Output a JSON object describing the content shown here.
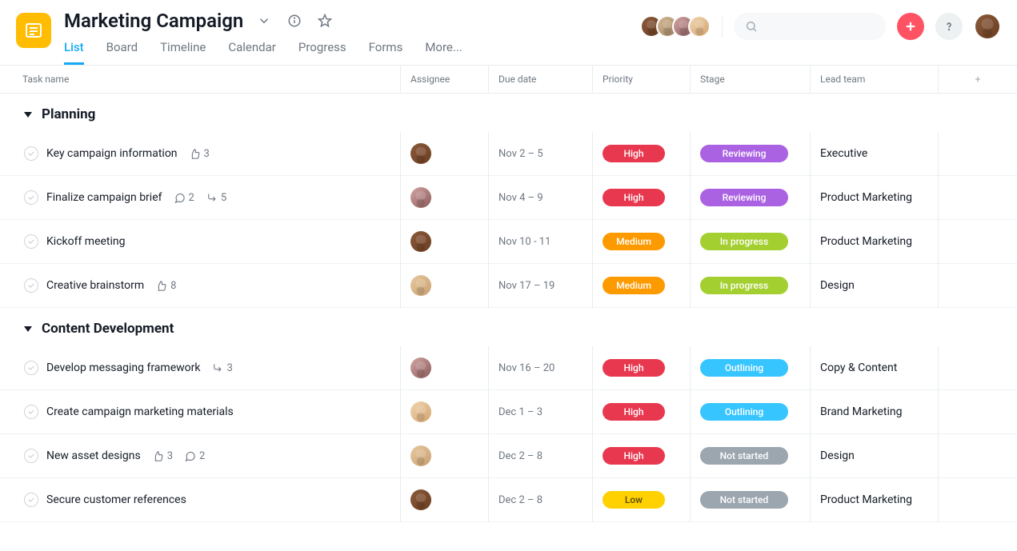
{
  "header": {
    "title": "Marketing Campaign",
    "tabs": [
      "List",
      "Board",
      "Timeline",
      "Calendar",
      "Progress",
      "Forms",
      "More..."
    ],
    "active_tab": 0
  },
  "columns": {
    "task": "Task name",
    "assignee": "Assignee",
    "due": "Due date",
    "priority": "Priority",
    "stage": "Stage",
    "lead": "Lead team",
    "add": "+"
  },
  "priority_colors": {
    "High": "#e8384f",
    "Medium": "#fd9a00",
    "Low": "#ffd100"
  },
  "stage_colors": {
    "Reviewing": "#aa62e3",
    "In progress": "#a4cf30",
    "Outlining": "#37c5ff",
    "Not started": "#9ca6af"
  },
  "avatar_classes": {
    "f1": "av-f1",
    "f2": "av-f2",
    "m1": "av-m1",
    "m2": "av-m2",
    "m3": "av-m3"
  },
  "member_avatars": [
    "f1",
    "m3",
    "f2",
    "m2"
  ],
  "user_avatar": "f1",
  "sections": [
    {
      "name": "Planning",
      "tasks": [
        {
          "title": "Key campaign information",
          "likes": 3,
          "comments": null,
          "subtasks": null,
          "assignee": "f1",
          "due": "Nov 2 – 5",
          "priority": "High",
          "stage": "Reviewing",
          "lead": "Executive"
        },
        {
          "title": "Finalize campaign brief",
          "likes": null,
          "comments": 2,
          "subtasks": 5,
          "assignee": "f2",
          "due": "Nov 4 – 9",
          "priority": "High",
          "stage": "Reviewing",
          "lead": "Product Marketing"
        },
        {
          "title": "Kickoff meeting",
          "likes": null,
          "comments": null,
          "subtasks": null,
          "assignee": "f1",
          "due": "Nov 10 - 11",
          "priority": "Medium",
          "stage": "In progress",
          "lead": "Product Marketing"
        },
        {
          "title": "Creative brainstorm",
          "likes": 8,
          "comments": null,
          "subtasks": null,
          "assignee": "m1",
          "due": "Nov 17 – 19",
          "priority": "Medium",
          "stage": "In progress",
          "lead": "Design"
        }
      ]
    },
    {
      "name": "Content Development",
      "tasks": [
        {
          "title": "Develop messaging framework",
          "likes": null,
          "comments": null,
          "subtasks": 3,
          "assignee": "f2",
          "due": "Nov 16 – 20",
          "priority": "High",
          "stage": "Outlining",
          "lead": "Copy & Content"
        },
        {
          "title": "Create campaign marketing materials",
          "likes": null,
          "comments": null,
          "subtasks": null,
          "assignee": "m2",
          "due": "Dec 1 – 3",
          "priority": "High",
          "stage": "Outlining",
          "lead": "Brand Marketing"
        },
        {
          "title": "New asset designs",
          "likes": 3,
          "comments": 2,
          "subtasks": null,
          "assignee": "m1",
          "due": "Dec 2 – 8",
          "priority": "High",
          "stage": "Not started",
          "lead": "Design"
        },
        {
          "title": "Secure customer references",
          "likes": null,
          "comments": null,
          "subtasks": null,
          "assignee": "f1",
          "due": "Dec 2 – 8",
          "priority": "Low",
          "stage": "Not started",
          "lead": "Product Marketing"
        }
      ]
    }
  ]
}
